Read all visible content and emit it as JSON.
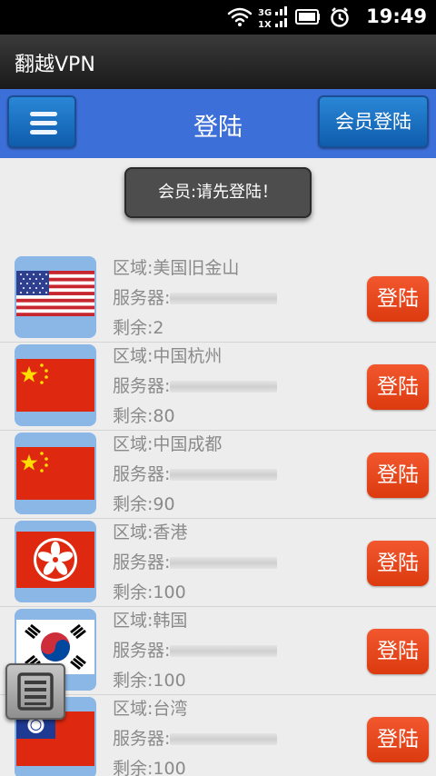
{
  "status_bar": {
    "time": "19:49",
    "icons": [
      "wifi-icon",
      "signal-3g-icon",
      "battery-icon",
      "alarm-icon"
    ],
    "network_label": "3G",
    "network_label2": "1X"
  },
  "app": {
    "title": "翻越VPN"
  },
  "header": {
    "title": "登陆",
    "member_login_label": "会员登陆",
    "menu_icon": "hamburger-icon"
  },
  "toast": {
    "text": "会员:请先登陆！"
  },
  "servers": [
    {
      "region": "区域:美国旧金山",
      "server_label": "服务器:",
      "remaining": "剩余:2",
      "flag": "usa",
      "login": "登陆"
    },
    {
      "region": "区域:中国杭州",
      "server_label": "服务器:",
      "remaining": "剩余:80",
      "flag": "china",
      "login": "登陆"
    },
    {
      "region": "区域:中国成都",
      "server_label": "服务器:",
      "remaining": "剩余:90",
      "flag": "china",
      "login": "登陆"
    },
    {
      "region": "区域:香港",
      "server_label": "服务器:",
      "remaining": "剩余:100",
      "flag": "hongkong",
      "login": "登陆"
    },
    {
      "region": "区域:韩国",
      "server_label": "服务器:",
      "remaining": "剩余:100",
      "flag": "korea",
      "login": "登陆"
    },
    {
      "region": "区域:台湾",
      "server_label": "服务器:",
      "remaining": "剩余:100",
      "flag": "taiwan",
      "login": "登陆"
    }
  ],
  "floating_button": {
    "icon": "list-icon"
  },
  "colors": {
    "header": "#3d6fd8",
    "login_button": "#e8481c",
    "menu_button": "#1e74c6"
  }
}
